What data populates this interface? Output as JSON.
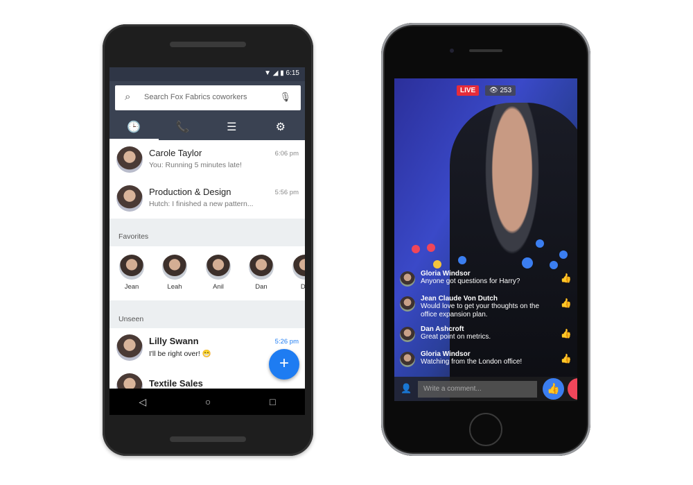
{
  "android": {
    "status": {
      "time": "6:15"
    },
    "search": {
      "placeholder": "Search Fox Fabrics coworkers"
    },
    "tabs": [
      {
        "icon": "clock-icon",
        "label": "🕒"
      },
      {
        "icon": "phone-icon",
        "label": "📞"
      },
      {
        "icon": "list-icon",
        "label": "☰"
      },
      {
        "icon": "gear-icon",
        "label": "⚙"
      }
    ],
    "recent": [
      {
        "name": "Carole Taylor",
        "message": "You: Running 5 minutes late!",
        "time": "6:06 pm"
      },
      {
        "name": "Production & Design",
        "message": "Hutch: I finished a new pattern...",
        "time": "5:56 pm"
      }
    ],
    "favorites_label": "Favorites",
    "favorites": [
      "Jean",
      "Leah",
      "Anil",
      "Dan",
      "Do"
    ],
    "unseen_label": "Unseen",
    "unseen": [
      {
        "name": "Lilly Swann",
        "message": "I'll be right over! 😁",
        "time": "5:26 pm"
      },
      {
        "name": "Textile Sales",
        "message": "",
        "time": ""
      }
    ],
    "fab": "+",
    "nav": [
      "◁",
      "○",
      "□"
    ]
  },
  "iphone": {
    "live_label": "LIVE",
    "viewers": "👁 253",
    "comments": [
      {
        "name": "Gloria Windsor",
        "text": "Anyone got questions for Harry?"
      },
      {
        "name": "Jean Claude Von Dutch",
        "text": "Would love to get your thoughts on the office expansion plan."
      },
      {
        "name": "Dan Ashcroft",
        "text": "Great point on metrics."
      },
      {
        "name": "Gloria Windsor",
        "text": "Watching from the London office!"
      }
    ],
    "comment_placeholder": "Write a comment...",
    "like_icon": "👍"
  },
  "colors": {
    "accent": "#1e7cf2",
    "live": "#e62c3a",
    "appbar": "#3a4252"
  }
}
